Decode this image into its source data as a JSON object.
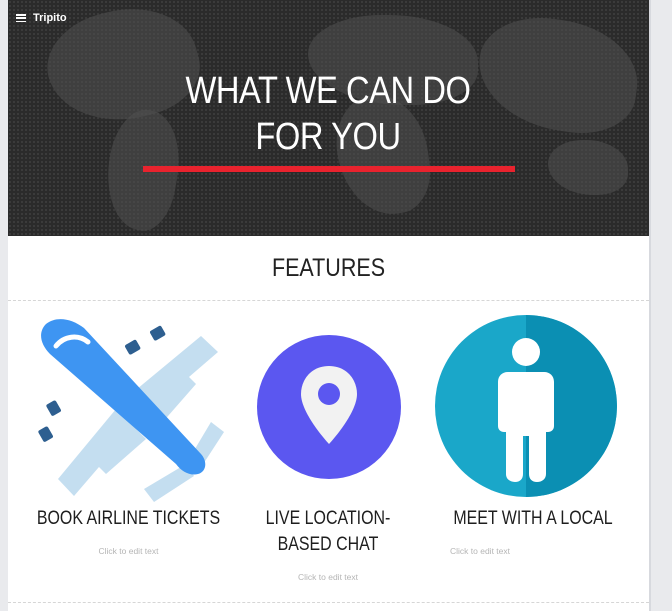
{
  "header": {
    "brand": "Tripito",
    "menu_icon": "hamburger-menu-icon"
  },
  "hero": {
    "title": "WHAT WE CAN DO FOR YOU",
    "underline_color": "#e9232e",
    "background": "world-map-dark"
  },
  "features": {
    "heading": "FEATURES",
    "items": [
      {
        "title": "BOOK AIRLINE TICKETS",
        "caption": "Click to edit text",
        "icon": "airplane-icon"
      },
      {
        "title": "LIVE LOCATION-BASED CHAT",
        "caption": "Click to edit text",
        "icon": "location-pin-icon"
      },
      {
        "title": "MEET WITH A LOCAL",
        "caption": "Click to edit text",
        "icon": "person-icon"
      }
    ]
  },
  "colors": {
    "accent_red": "#e9232e",
    "pin_circle": "#5b57f0",
    "person_circle": "#1aa7c9",
    "plane_blue": "#3e95f2"
  }
}
